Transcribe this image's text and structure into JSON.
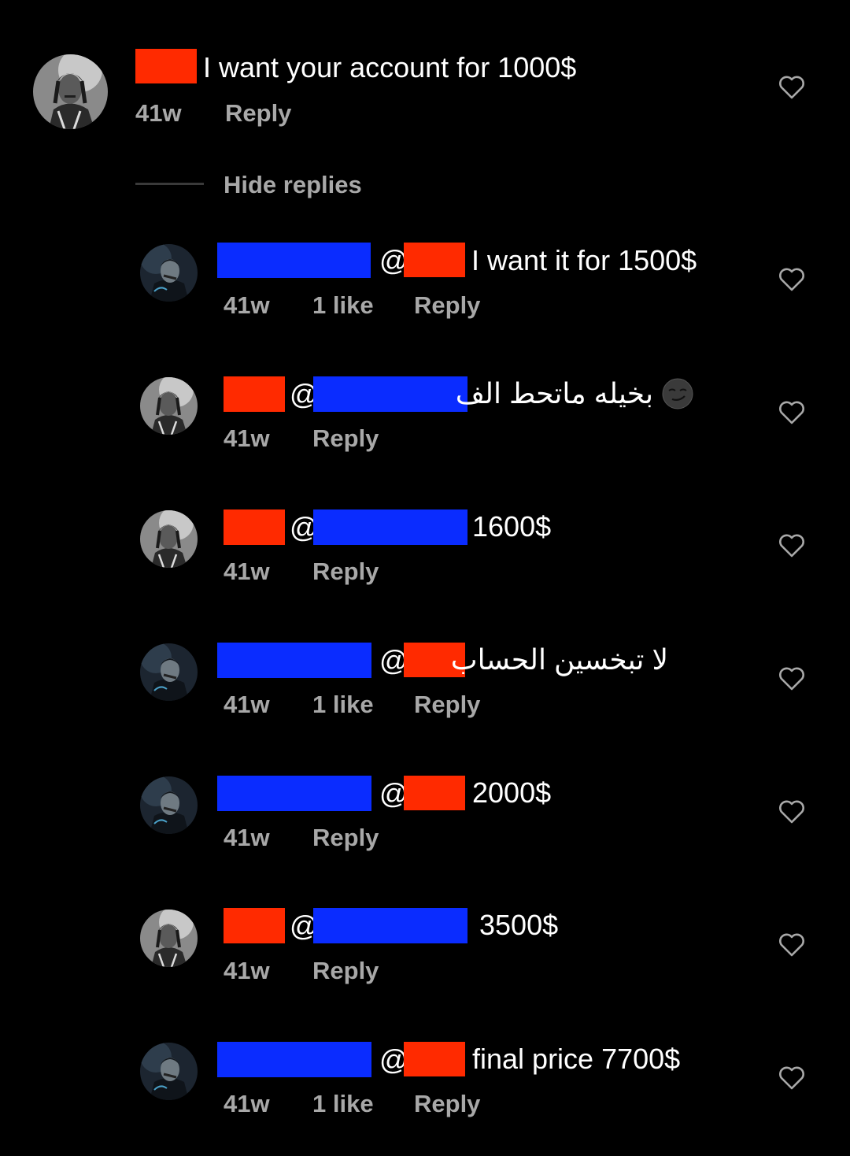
{
  "colors": {
    "background": "#000000",
    "meta_text": "#a8a8a8",
    "redact_red": "#ff2a00",
    "redact_blue": "#0a2cff"
  },
  "main_comment": {
    "text": "I want your account for 1000$",
    "time": "41w",
    "reply_label": "Reply",
    "heart_icon": "heart-outline-icon"
  },
  "thread": {
    "hide_replies_label": "Hide replies"
  },
  "replies": [
    {
      "mention": "@",
      "text": "I want it for 1500$",
      "time": "41w",
      "likes": "1 like",
      "reply_label": "Reply"
    },
    {
      "mention": "@",
      "text": "بخيله ماتحط الف",
      "time": "41w",
      "reply_label": "Reply",
      "emoji": "smirk-emoji"
    },
    {
      "mention": "@",
      "text": "1600$",
      "time": "41w",
      "reply_label": "Reply"
    },
    {
      "mention": "@",
      "text": "لا تبخسين الحساب",
      "time": "41w",
      "likes": "1 like",
      "reply_label": "Reply"
    },
    {
      "mention": "@",
      "text": "2000$",
      "time": "41w",
      "reply_label": "Reply"
    },
    {
      "mention": "@",
      "text": "3500$",
      "time": "41w",
      "reply_label": "Reply"
    },
    {
      "mention": "@",
      "text": "final price 7700$",
      "time": "41w",
      "likes": "1 like",
      "reply_label": "Reply"
    }
  ]
}
